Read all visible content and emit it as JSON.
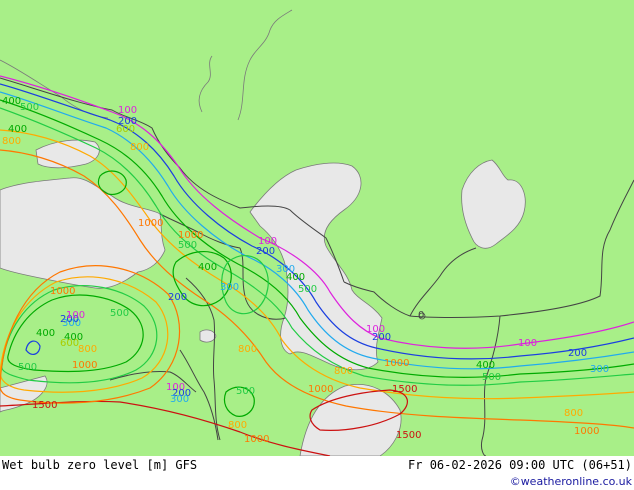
{
  "colors": {
    "land": "#a8ef88",
    "sea": "#e8e8e8",
    "coast": "#7a7a7a",
    "border": "#444444",
    "c100": "#dd22dd",
    "c200": "#1b3fe0",
    "c300": "#22aaee",
    "c400": "#00aa00",
    "c500": "#22cc44",
    "c600": "#aacc00",
    "c800": "#ffaa00",
    "c1000": "#ff7700",
    "c1500": "#cc1111"
  },
  "legend": {
    "title": "Wet bulb zero level [m] GFS",
    "datetime": "Fr 06-02-2026 09:00 UTC (06+51)",
    "credit": "©weatheronline.co.uk"
  },
  "contour_labels": [
    {
      "text": "400",
      "level": "c400"
    },
    {
      "text": "500",
      "level": "c500"
    },
    {
      "text": "100",
      "level": "c100"
    },
    {
      "text": "200",
      "level": "c200"
    },
    {
      "text": "600",
      "level": "c600"
    },
    {
      "text": "800",
      "level": "c800"
    },
    {
      "text": "400",
      "level": "c400"
    },
    {
      "text": "800",
      "level": "c800"
    },
    {
      "text": "1000",
      "level": "c1000"
    },
    {
      "text": "1000",
      "level": "c1000"
    },
    {
      "text": "500",
      "level": "c500"
    },
    {
      "text": "400",
      "level": "c400"
    },
    {
      "text": "100",
      "level": "c100"
    },
    {
      "text": "200",
      "level": "c200"
    },
    {
      "text": "300",
      "level": "c300"
    },
    {
      "text": "400",
      "level": "c400"
    },
    {
      "text": "500",
      "level": "c500"
    },
    {
      "text": "300",
      "level": "c300"
    },
    {
      "text": "200",
      "level": "c200"
    },
    {
      "text": "1000",
      "level": "c1000"
    },
    {
      "text": "500",
      "level": "c500"
    },
    {
      "text": "400",
      "level": "c400"
    },
    {
      "text": "300",
      "level": "c300"
    },
    {
      "text": "200",
      "level": "c200"
    },
    {
      "text": "100",
      "level": "c100"
    },
    {
      "text": "600",
      "level": "c600"
    },
    {
      "text": "800",
      "level": "c800"
    },
    {
      "text": "1000",
      "level": "c1000"
    },
    {
      "text": "500",
      "level": "c500"
    },
    {
      "text": "400",
      "level": "c400"
    },
    {
      "text": "800",
      "level": "c800"
    },
    {
      "text": "1500",
      "level": "c1500"
    },
    {
      "text": "100",
      "level": "c100"
    },
    {
      "text": "200",
      "level": "c200"
    },
    {
      "text": "300",
      "level": "c300"
    },
    {
      "text": "500",
      "level": "c500"
    },
    {
      "text": "800",
      "level": "c800"
    },
    {
      "text": "1000",
      "level": "c1000"
    },
    {
      "text": "1000",
      "level": "c1000"
    },
    {
      "text": "100",
      "level": "c100"
    },
    {
      "text": "200",
      "level": "c200"
    },
    {
      "text": "800",
      "level": "c800"
    },
    {
      "text": "1000",
      "level": "c1000"
    },
    {
      "text": "1500",
      "level": "c1500"
    },
    {
      "text": "100",
      "level": "c100"
    },
    {
      "text": "200",
      "level": "c200"
    },
    {
      "text": "300",
      "level": "c300"
    },
    {
      "text": "400",
      "level": "c400"
    },
    {
      "text": "500",
      "level": "c500"
    },
    {
      "text": "800",
      "level": "c800"
    },
    {
      "text": "1000",
      "level": "c1000"
    },
    {
      "text": "1500",
      "level": "c1500"
    },
    {
      "text": "0",
      "level": "border"
    }
  ]
}
